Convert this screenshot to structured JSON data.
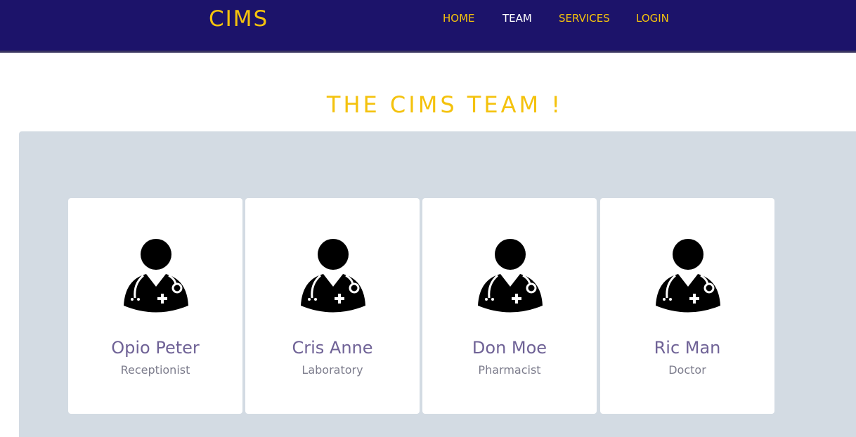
{
  "brand": "CIMS",
  "nav": {
    "home": "HOME",
    "team": "TEAM",
    "services": "SERVICES",
    "login": "LOGIN"
  },
  "section_title": "THE CIMS TEAM !",
  "members": [
    {
      "name": "Opio Peter",
      "role": "Receptionist",
      "icon": "doctor-icon"
    },
    {
      "name": "Cris Anne",
      "role": "Laboratory",
      "icon": "doctor-icon"
    },
    {
      "name": "Don Moe",
      "role": "Pharmacist",
      "icon": "doctor-icon"
    },
    {
      "name": "Ric Man",
      "role": "Doctor",
      "icon": "doctor-icon"
    }
  ],
  "colors": {
    "navbar": "#1c136a",
    "accent": "#f4c20d",
    "panel": "#d3dbe3",
    "name_text": "#6f6296"
  }
}
